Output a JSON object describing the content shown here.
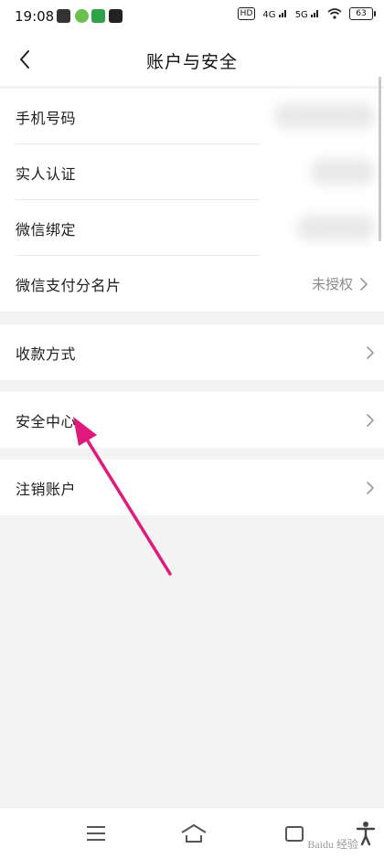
{
  "status_bar": {
    "time": "19:08",
    "hd_label": "HD",
    "net1": "4G",
    "net2": "5G",
    "battery": "63"
  },
  "header": {
    "title": "账户与安全",
    "back_icon": "chevron-left-icon"
  },
  "rows": [
    {
      "label": "手机号码"
    },
    {
      "label": "实人认证"
    },
    {
      "label": "微信绑定"
    },
    {
      "label": "微信支付分名片",
      "value": "未授权"
    },
    {
      "label": "收款方式"
    },
    {
      "label": "安全中心"
    },
    {
      "label": "注销账户"
    }
  ],
  "colors": {
    "background": "#f3f3f3",
    "card": "#ffffff",
    "annotation_arrow": "#e0197a"
  },
  "watermark": "Baidu 经验"
}
